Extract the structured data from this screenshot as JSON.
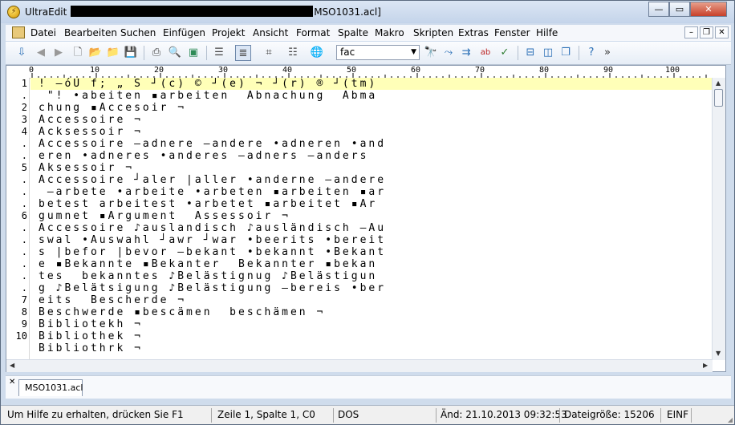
{
  "window": {
    "app_name": "UltraEdit",
    "title_suffix": "MSO1031.acl]",
    "controls": {
      "minimize": "—",
      "maximize": "▭",
      "close": "✕"
    }
  },
  "menu": {
    "items": [
      "Datei",
      "Bearbeiten",
      "Suchen",
      "Einfügen",
      "Projekt",
      "Ansicht",
      "Format",
      "Spalte",
      "Makro",
      "Skripten",
      "Extras",
      "Fenster",
      "Hilfe"
    ],
    "mdi": {
      "minimize": "–",
      "restore": "❐",
      "close": "✕"
    }
  },
  "toolbar": {
    "search_value": "fac",
    "more": "»"
  },
  "ruler": {
    "labels": [
      "0",
      "10",
      "20",
      "30",
      "40",
      "50",
      "60",
      "70",
      "80",
      "90",
      "100"
    ]
  },
  "editor": {
    "line_numbers": [
      "1",
      ".",
      "2",
      "3",
      "4",
      ".",
      ".",
      "5",
      ".",
      ".",
      ".",
      "6",
      ".",
      ".",
      ".",
      ".",
      ".",
      ".",
      "7",
      "8",
      "9",
      "10"
    ],
    "lines": [
      "! –óU f; „ Š ┘(c) © ┘(e) ¬ ┘(r) ® ┘(tm)",
      " \"! •abeiten ▪arbeiten  Abnachung  Abma",
      "chung ▪Accesoir ¬",
      "Accessoire ¬",
      "Acksessoir ¬",
      "Accessoire –adnere –andere •adneren •and",
      "eren •adneres •anderes –adners –anders",
      "Aksessoir ¬",
      "Accessoire ┘aler |aller •anderne –andere",
      " –arbete •arbeite •arbeten ▪arbeiten ▪ar",
      "betest arbeitest •arbetet ▪arbeitet ▪Ar",
      "gumnet ▪Argument  Assessoir ¬",
      "Accessoire ♪auslandisch ♪ausländisch –Au",
      "swal •Auswahl ┘awr ┘war •beerits •bereit",
      "s |befor |bevor –bekant •bekannt •Bekant",
      "e ▪Bekannte ▪Bekanter  Bekannter ▪bekan",
      "tes  bekanntes ♪Belästignug ♪Belästigun",
      "g ♪Belätsigung ♪Belästigung –bereis •ber",
      "eits  Bescherde ¬",
      "Beschwerde ▪bescämen  beschämen ¬",
      "Bibliotekh ¬",
      "Bibliothek ¬",
      "Bibliothrk ¬"
    ]
  },
  "tabs": [
    {
      "label": "MSO1031.acl",
      "close": "✕"
    }
  ],
  "status": {
    "help": "Um Hilfe zu erhalten, drücken Sie F1",
    "position": "Zeile 1, Spalte 1, C0",
    "line_ending": "DOS",
    "modified": "Änd: 21.10.2013 09:32:53",
    "filesize": "Dateigröße: 15206",
    "insert_mode": "EINF"
  }
}
